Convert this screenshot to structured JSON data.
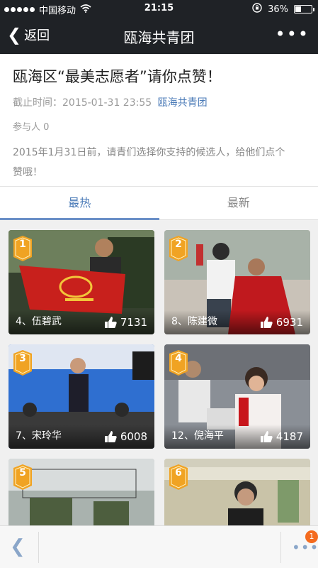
{
  "status_bar": {
    "carrier": "中国移动",
    "time": "21:15",
    "battery": "36%",
    "battery_level": 0.36
  },
  "nav": {
    "back_label": "返回",
    "title": "瓯海共青团"
  },
  "header": {
    "title": "瓯海区“最美志愿者”请你点赞！",
    "deadline_label": "截止时间：",
    "deadline": "2015-01-31 23:55",
    "organizer": "瓯海共青团",
    "participants": "参与人 0",
    "description": "2015年1月31日前，请青们选择你支持的候选人，给他们点个赞哦！"
  },
  "tabs": [
    {
      "label": "最热",
      "active": true
    },
    {
      "label": "最新",
      "active": false
    }
  ],
  "candidates": [
    {
      "rank": "1",
      "name": "4、伍碧武",
      "likes": "7131"
    },
    {
      "rank": "2",
      "name": "8、陈建微",
      "likes": "6931"
    },
    {
      "rank": "3",
      "name": "7、宋玲华",
      "likes": "6008"
    },
    {
      "rank": "4",
      "name": "12、倪海平",
      "likes": "4187"
    },
    {
      "rank": "5",
      "name": "",
      "likes": ""
    },
    {
      "rank": "6",
      "name": "",
      "likes": ""
    }
  ],
  "bottom_bar": {
    "badge_count": "1"
  },
  "colors": {
    "bar": "#1f2226",
    "accent": "#4a7ab7",
    "badge_orange": "#f0a323",
    "notify": "#f46b1f"
  }
}
